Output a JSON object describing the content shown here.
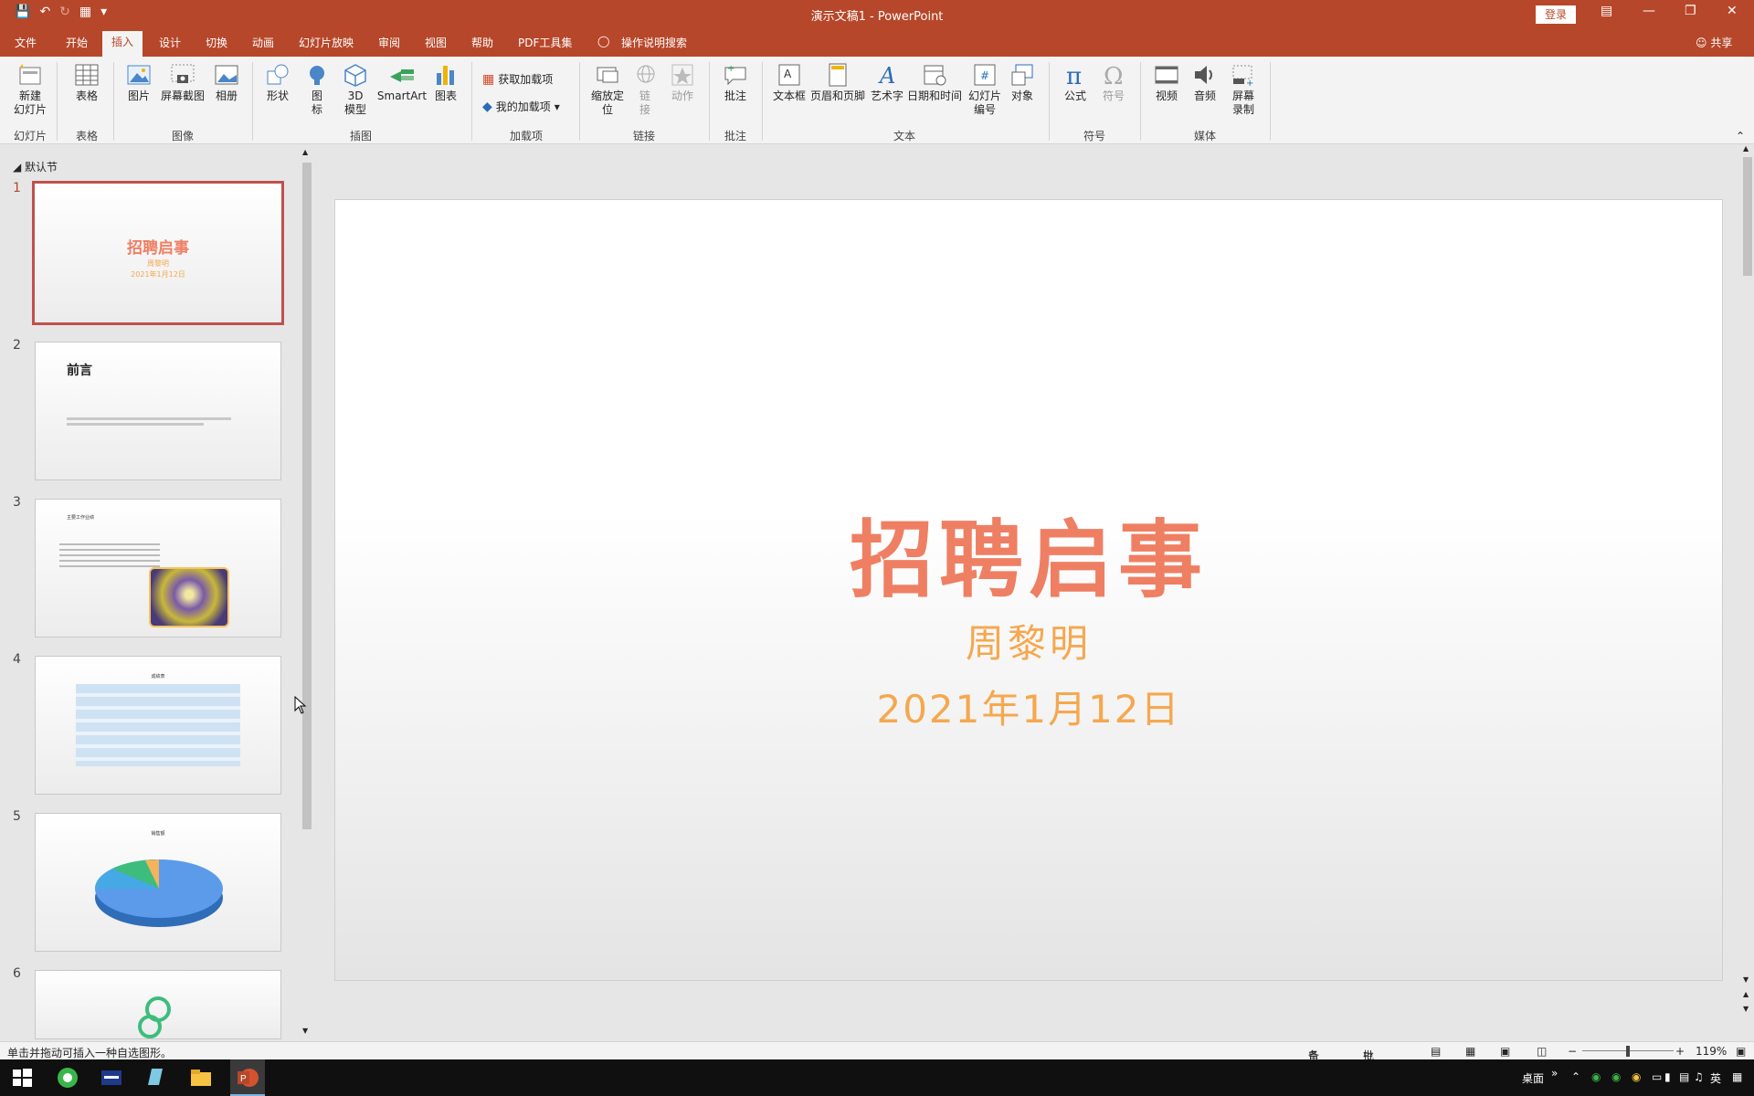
{
  "window": {
    "title": "演示文稿1  -  PowerPoint",
    "login_label": "登录",
    "share_label": "共享"
  },
  "tabs": [
    {
      "label": "文件"
    },
    {
      "label": "开始"
    },
    {
      "label": "插入",
      "active": true
    },
    {
      "label": "设计"
    },
    {
      "label": "切换"
    },
    {
      "label": "动画"
    },
    {
      "label": "幻灯片放映"
    },
    {
      "label": "审阅"
    },
    {
      "label": "视图"
    },
    {
      "label": "帮助"
    },
    {
      "label": "PDF工具集"
    },
    {
      "label": "操作说明搜索"
    }
  ],
  "ribbon": {
    "new_slide": "新建\n幻灯片",
    "table": "表格",
    "picture": "图片",
    "screenshot": "屏幕截图",
    "album": "相册",
    "shapes": "形状",
    "icons": "图\n标",
    "model3d": "3D\n模型",
    "smartart": "SmartArt",
    "chart": "图表",
    "get_addins": "获取加载项",
    "my_addins": "我的加载项",
    "zoom": "缩放定\n位",
    "link": "链\n接",
    "action": "动作",
    "comment": "批注",
    "textbox": "文本框",
    "header_footer": "页眉和页脚",
    "wordart": "艺术字",
    "datetime": "日期和时间",
    "slide_number": "幻灯片\n编号",
    "object": "对象",
    "equation": "公式",
    "symbol": "符号",
    "video": "视频",
    "audio": "音频",
    "screen_record": "屏幕\n录制",
    "groups": {
      "slides": "幻灯片",
      "tables": "表格",
      "images": "图像",
      "illustrations": "插图",
      "addins": "加载项",
      "links": "链接",
      "comments": "批注",
      "text": "文本",
      "symbols": "符号",
      "media": "媒体"
    }
  },
  "thumbpane": {
    "section_label": "默认节",
    "slides": [
      {
        "num": "1",
        "title": "招聘启事",
        "sub": "周黎明",
        "date": "2021年1月12日"
      },
      {
        "num": "2",
        "title": "前言"
      },
      {
        "num": "3",
        "title": "主要工作业绩"
      },
      {
        "num": "4",
        "title": "成绩表"
      },
      {
        "num": "5",
        "title": "销售额"
      },
      {
        "num": "6"
      }
    ]
  },
  "slide": {
    "title": "招聘启事",
    "subtitle": "周黎明",
    "date": "2021年1月12日"
  },
  "status": {
    "hint": "单击并拖动可插入一种自选图形。",
    "notes": "备注",
    "comments": "批注",
    "zoom": "119%"
  },
  "taskbar": {
    "desktop": "桌面",
    "ime": "英"
  },
  "colors": {
    "accent": "#b7472a",
    "title": "#ef7f63",
    "subtitle": "#f5a84f"
  }
}
